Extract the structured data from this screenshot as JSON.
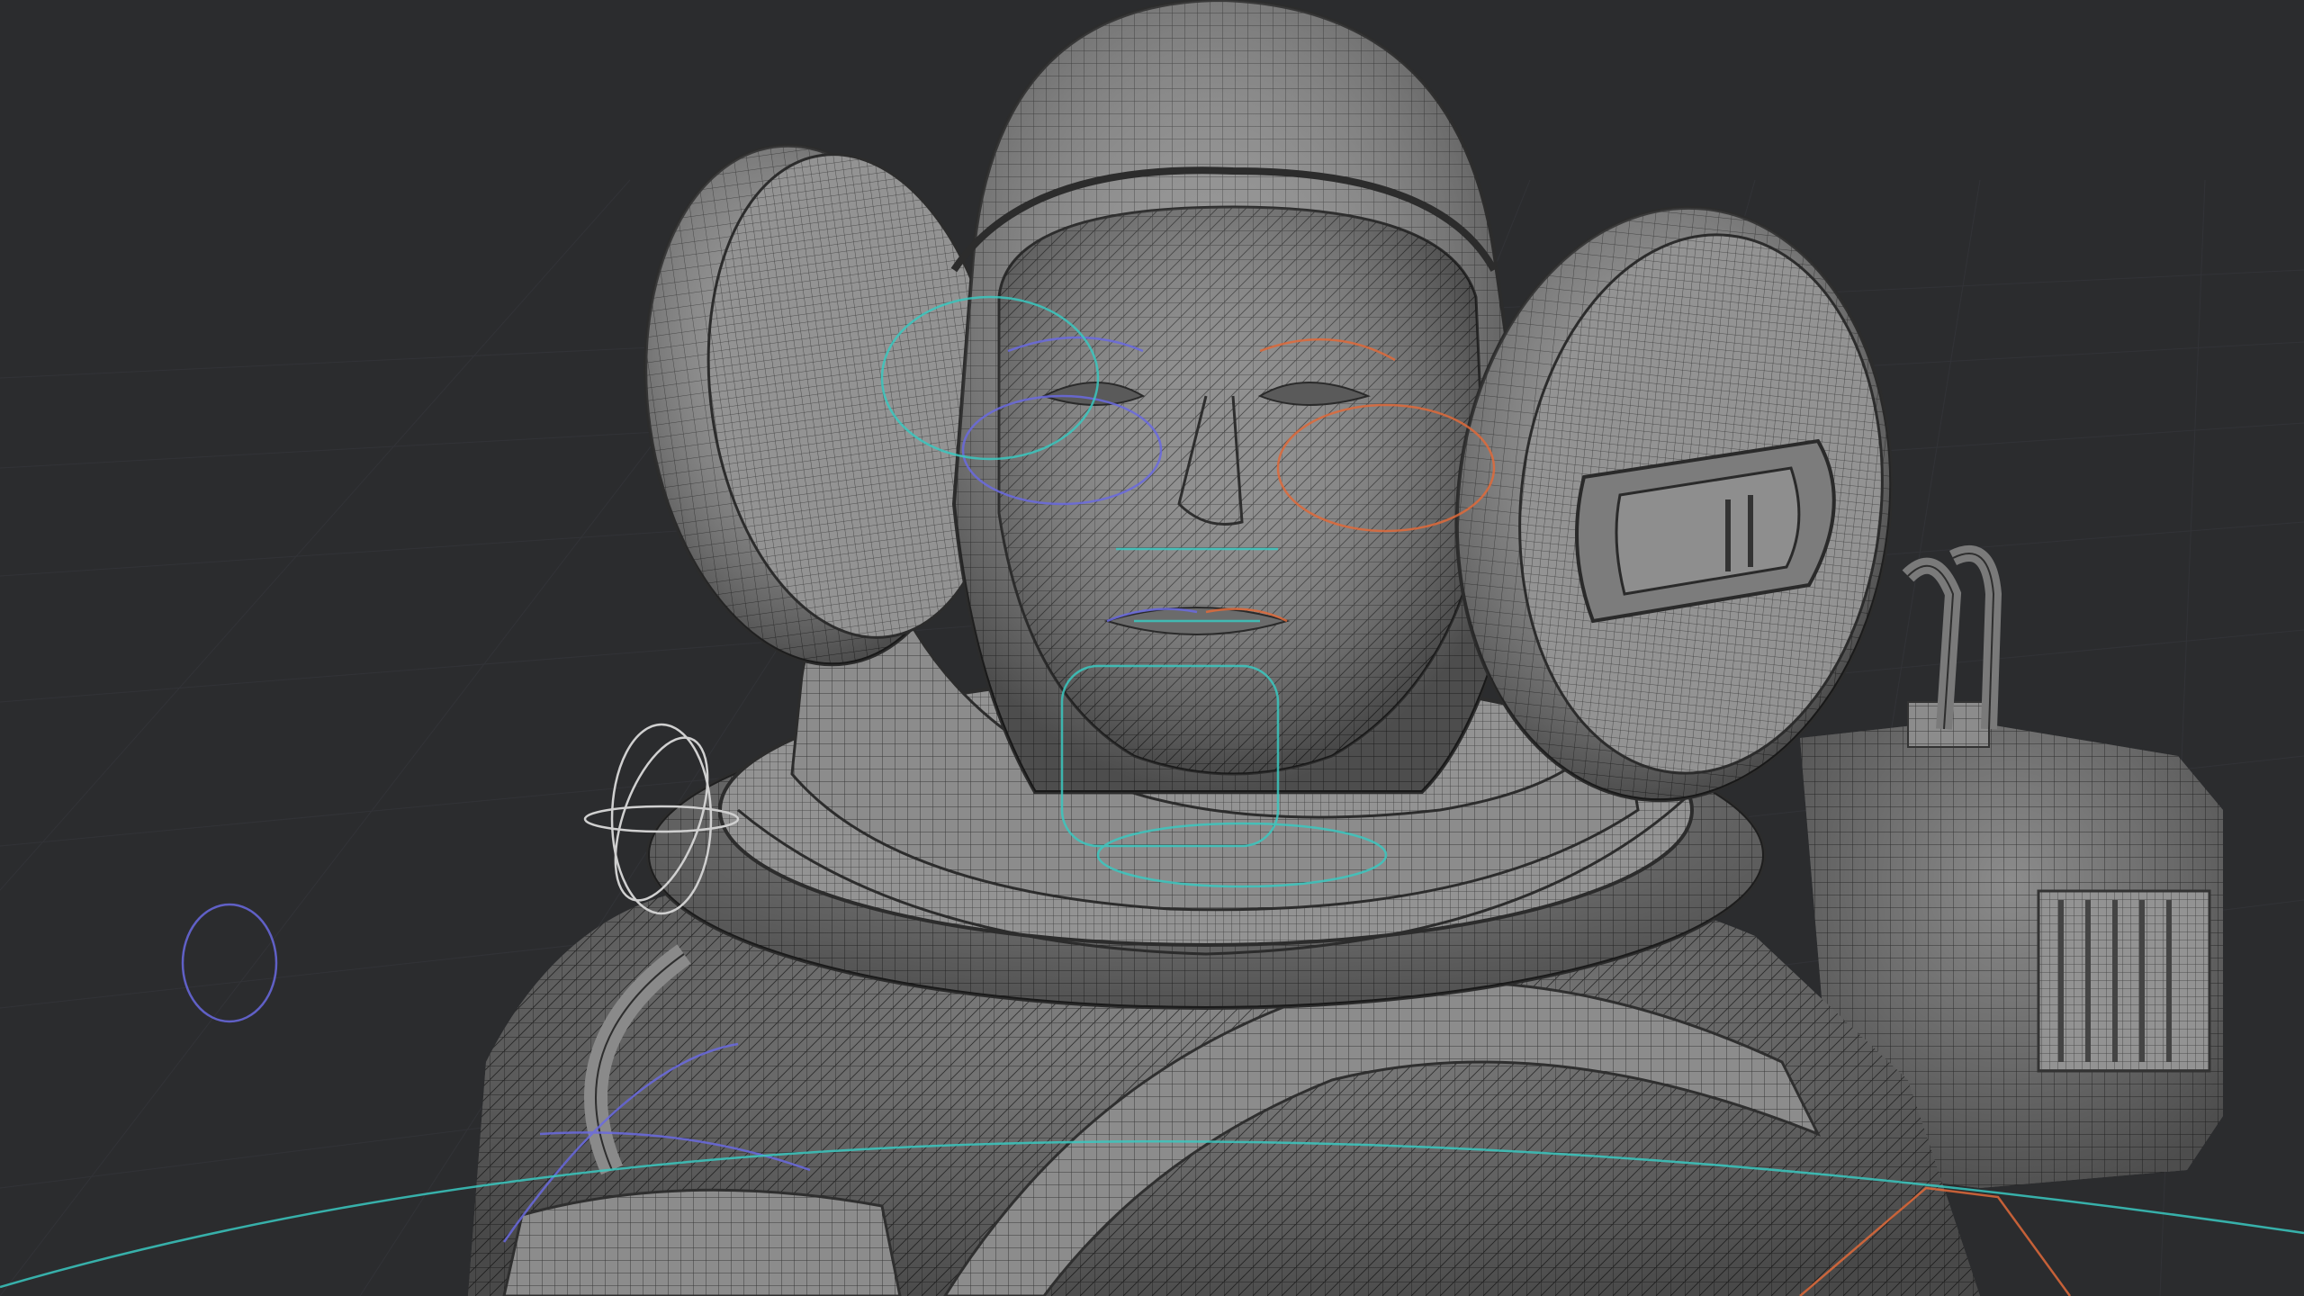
{
  "scene": {
    "subject": "astronaut-wireframe-model",
    "colors": {
      "background": "#2b2c2e",
      "grid": "#3a3b3e",
      "mesh_fill": "#8e8e8e",
      "mesh_wire": "#2e2e2e",
      "rig_left": "#6a6ae0",
      "rig_right": "#e06a3a",
      "rig_center": "#3ac8c0",
      "rig_neutral": "#d0d0d0"
    }
  }
}
